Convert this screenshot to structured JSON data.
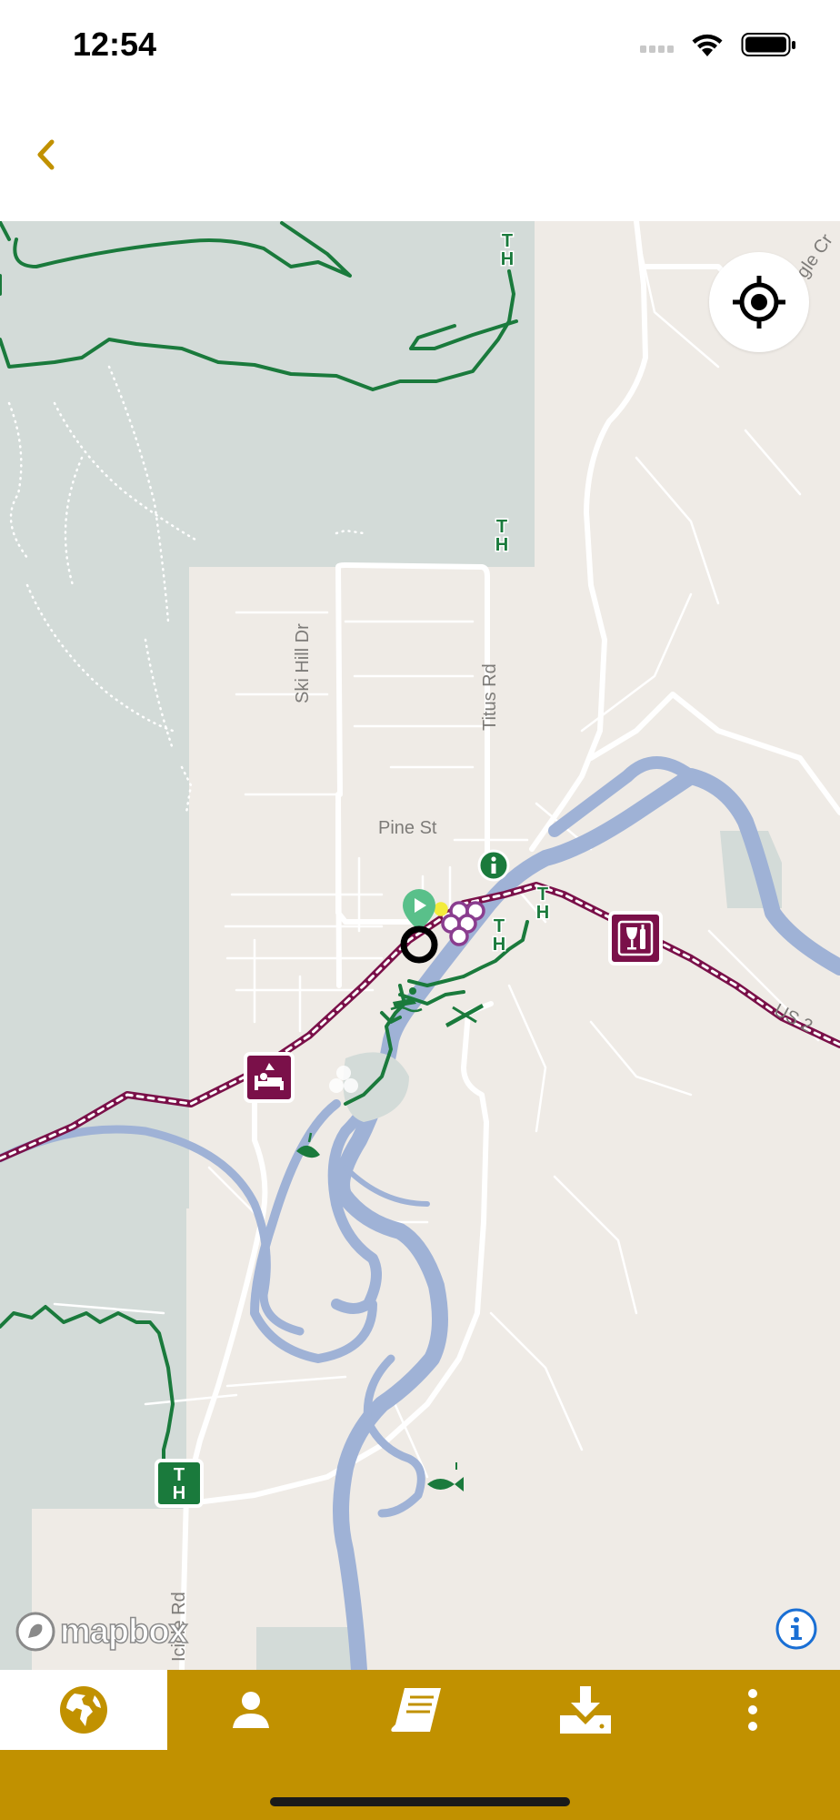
{
  "status_bar": {
    "time": "12:54"
  },
  "map": {
    "road_labels": {
      "ski_hill_dr": "Ski Hill Dr",
      "titus_rd": "Titus Rd",
      "pine_st": "Pine St",
      "icicle_rd": "Icicle Rd",
      "us_2": "US 2",
      "eagle_cr": "gle Cr"
    },
    "attribution": "mapbox"
  },
  "tabs": [
    {
      "name": "map",
      "icon": "globe-icon"
    },
    {
      "name": "profile",
      "icon": "person-icon"
    },
    {
      "name": "guide",
      "icon": "book-icon"
    },
    {
      "name": "downloads",
      "icon": "download-icon"
    },
    {
      "name": "more",
      "icon": "more-vertical-icon"
    }
  ],
  "colors": {
    "accent": "#c19100",
    "trail_green": "#1a7a3c",
    "route_maroon": "#7a1049",
    "river_blue": "#9fb2d6",
    "forest_gray": "#d3dbd8",
    "land": "#efebe6",
    "link_blue": "#1a6fd4"
  }
}
